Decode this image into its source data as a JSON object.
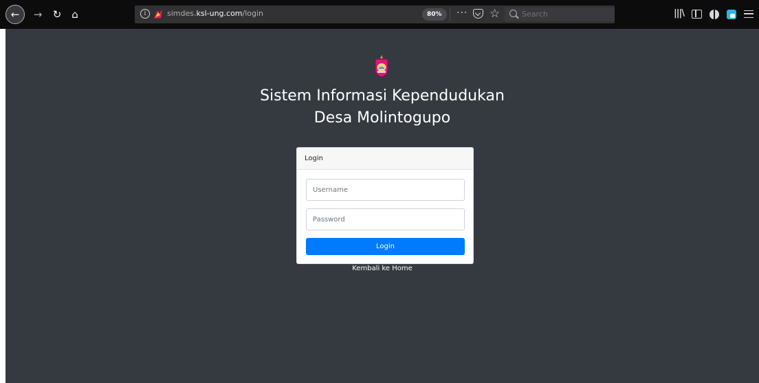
{
  "browser": {
    "url_prefix": "simdes.",
    "url_domain": "ksl-ung.com",
    "url_path": "/login",
    "zoom_level": "80%",
    "page_actions_label": "···",
    "search_placeholder": "Search",
    "icons": {
      "back": "back-arrow-icon",
      "forward": "forward-arrow-icon",
      "reload": "reload-icon",
      "home": "home-icon",
      "info": "info-icon",
      "pocket": "pocket-icon",
      "bookmark": "star-icon",
      "library": "library-icon",
      "sidebar": "sidebar-icon",
      "globe": "globe-icon",
      "extension": "extension-icon",
      "menu": "hamburger-menu-icon"
    }
  },
  "page": {
    "background_color": "#343a40",
    "title_line1": "Sistem Informasi Kependudukan",
    "title_line2": "Desa Molintogupo",
    "login_card": {
      "header": "Login",
      "username_placeholder": "Username",
      "password_placeholder": "Password",
      "submit_label": "Login",
      "button_color": "#007bff"
    },
    "back_link": "Kembali ke Home"
  }
}
